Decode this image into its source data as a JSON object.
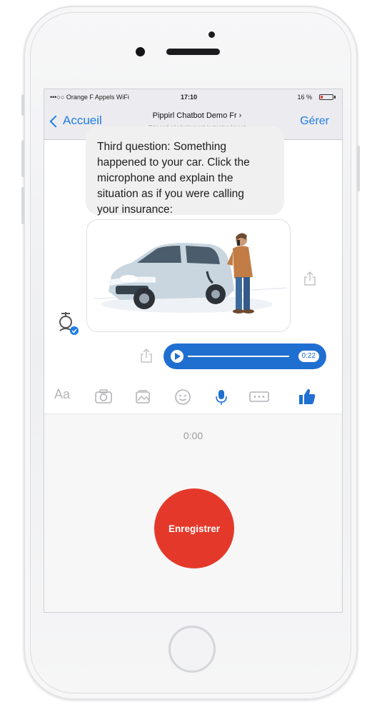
{
  "status_bar": {
    "carrier": "•••○○ Orange F Appels WiFi",
    "time": "17:10",
    "battery": "16 %"
  },
  "nav": {
    "back_label": "Accueil",
    "title": "Pippirl Chatbot Demo Fr ›",
    "subtitle": "Répond généralement instantanément",
    "manage_label": "Gérer"
  },
  "chat": {
    "message_text": "Third question: Something\nhappened to your car. Click the\nmicrophone and explain the\nsituation as if you were calling\nyour insurance:",
    "audio_duration": "0:22"
  },
  "composer": {
    "aa_label": "Aa",
    "icons": [
      "camera-icon",
      "gallery-icon",
      "emoji-icon",
      "microphone-icon",
      "more-icon",
      "thumbs-up-icon"
    ]
  },
  "recorder": {
    "elapsed": "0:00",
    "record_label": "Enregistrer"
  },
  "colors": {
    "accent_blue": "#1f7ce6",
    "audio_blue": "#1f6fd1",
    "record_red": "#e4392a"
  }
}
